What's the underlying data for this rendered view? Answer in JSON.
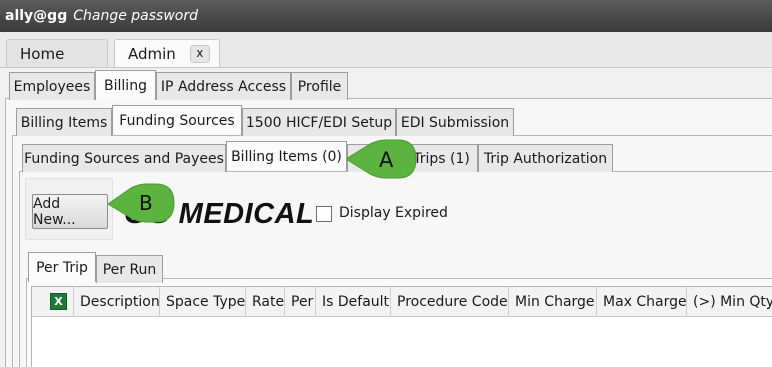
{
  "titlebar": {
    "user": "ally@gg",
    "change_password": "Change password"
  },
  "top_tabs": {
    "home": "Home",
    "admin": "Admin",
    "close": "x"
  },
  "admin_tabs": [
    "Employees",
    "Billing",
    "IP Address Access",
    "Profile"
  ],
  "billing_tabs": [
    "Billing Items",
    "Funding Sources",
    "1500 HICF/EDI Setup",
    "EDI Submission"
  ],
  "funding_tabs": [
    "Funding Sources and Payees",
    "Billing Items (0)",
    "Regular Trips (1)",
    "Trip Authorization"
  ],
  "toolbar": {
    "add_new": "Add New...",
    "company": "GG MEDICAL",
    "display_expired": "Display Expired"
  },
  "rate_tabs": [
    "Per Trip",
    "Per Run"
  ],
  "grid": {
    "columns": [
      "Description",
      "Space Type",
      "Rate",
      "Per",
      "Is Default",
      "Procedure Code",
      "Min Charge",
      "Max Charge",
      "(>) Min Qty"
    ]
  },
  "callouts": {
    "a": "A",
    "b": "B"
  },
  "colors": {
    "callout": "#5cb33f",
    "titlebar": "#4a4a4a"
  }
}
